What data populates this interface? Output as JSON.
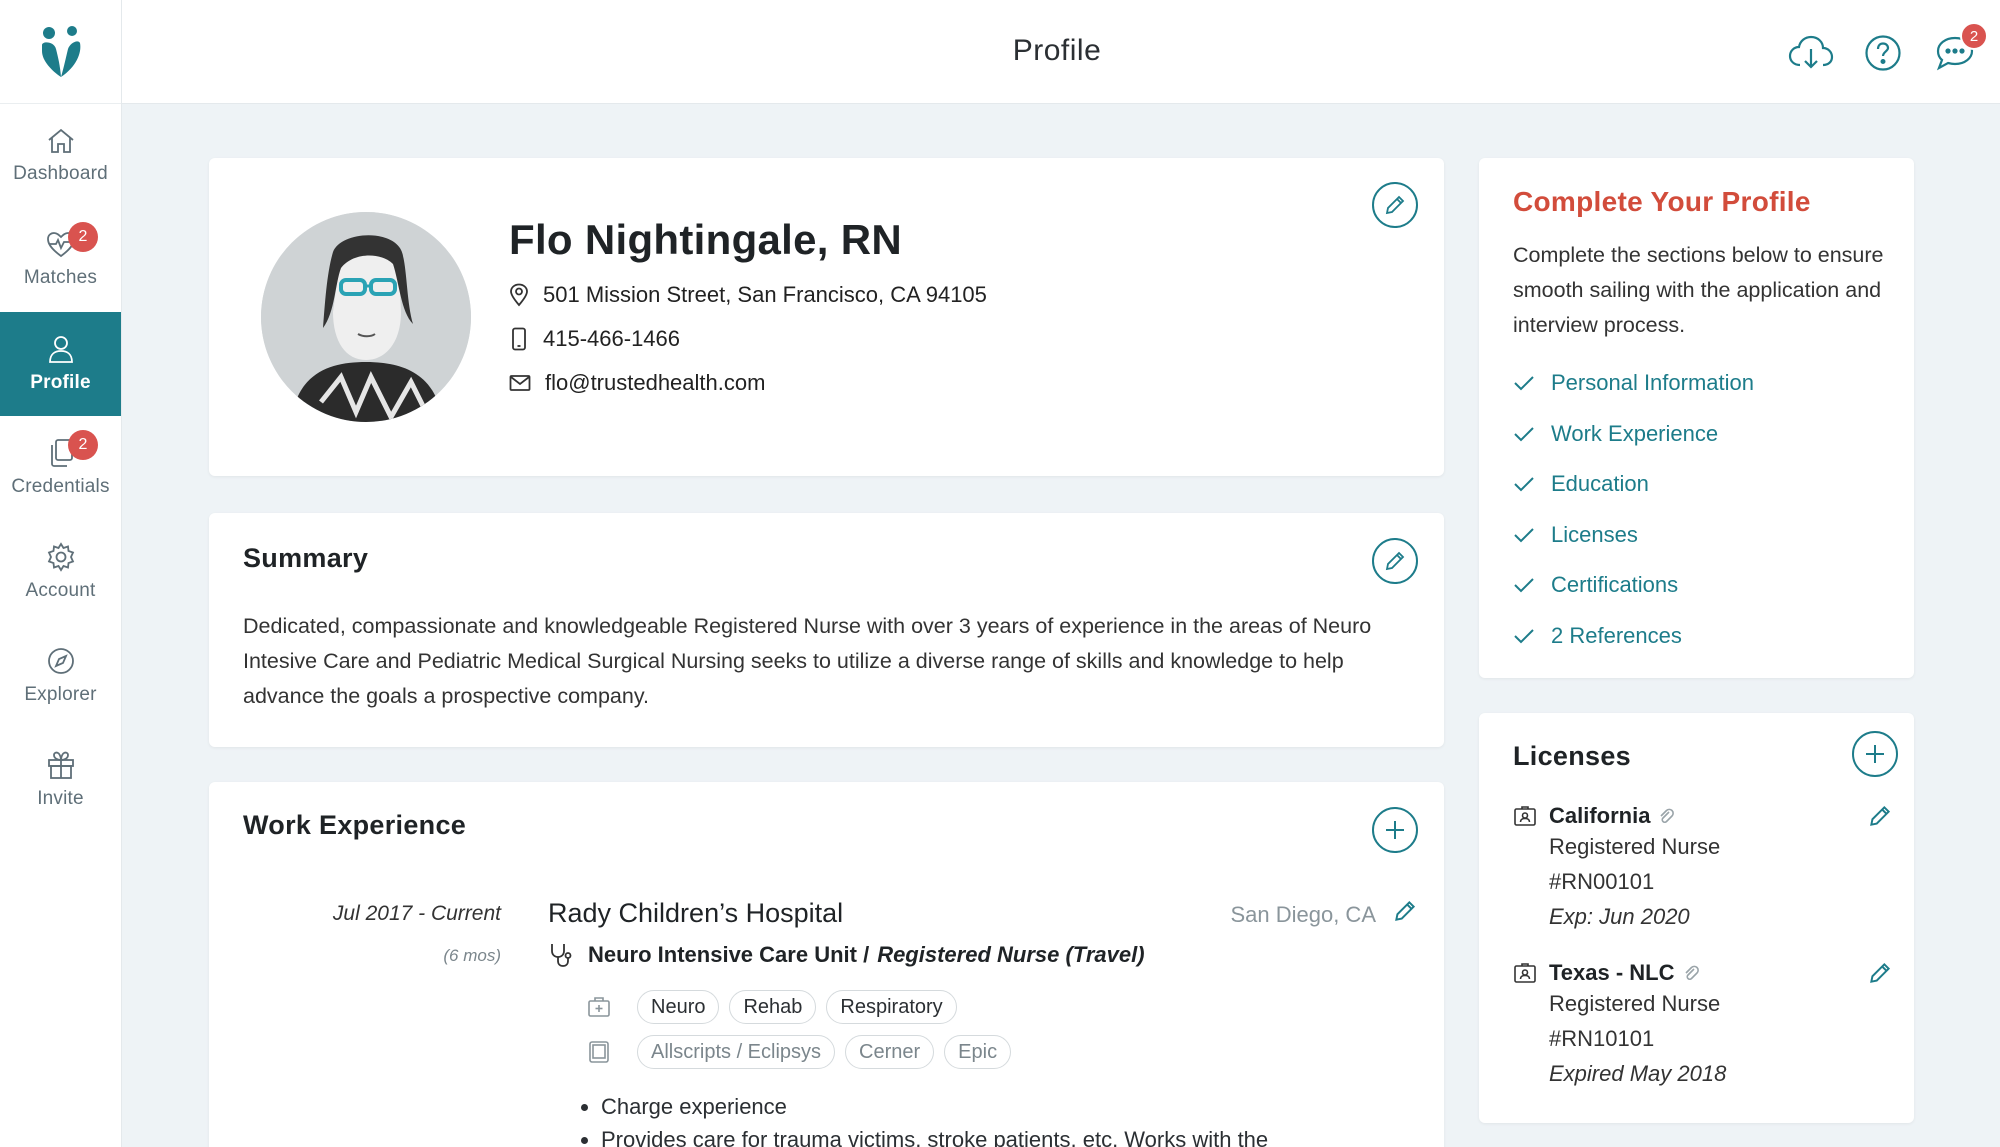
{
  "header": {
    "title": "Profile",
    "message_count": "2"
  },
  "nav": [
    {
      "label": "Dashboard",
      "icon": "home-icon",
      "badge": ""
    },
    {
      "label": "Matches",
      "icon": "heartbeat-icon",
      "badge": "2"
    },
    {
      "label": "Profile",
      "icon": "user-icon",
      "badge": "",
      "active": true
    },
    {
      "label": "Credentials",
      "icon": "documents-icon",
      "badge": "2"
    },
    {
      "label": "Account",
      "icon": "gear-icon",
      "badge": ""
    },
    {
      "label": "Explorer",
      "icon": "compass-icon",
      "badge": ""
    },
    {
      "label": "Invite",
      "icon": "gift-icon",
      "badge": ""
    }
  ],
  "profile": {
    "name": "Flo Nightingale, RN",
    "address": "501 Mission Street, San Francisco, CA 94105",
    "phone": "415-466-1466",
    "email": "flo@trustedhealth.com"
  },
  "summary": {
    "title": "Summary",
    "text": "Dedicated, compassionate and knowledgeable Registered Nurse with over 3 years of experience in the areas of Neuro Intesive Care and Pediatric Medical Surgical Nursing seeks to utilize a diverse range of skills and knowledge to help advance the goals a prospective company."
  },
  "work": {
    "title": "Work Experience",
    "date_range": "Jul 2017 - Current",
    "duration": "(6 mos)",
    "employer": "Rady Children’s Hospital",
    "location": "San Diego, CA",
    "unit": "Neuro Intensive Care Unit /",
    "role": "Registered Nurse (Travel)",
    "specialties": [
      "Neuro",
      "Rehab",
      "Respiratory"
    ],
    "systems": [
      "Allscripts / Eclipsys",
      "Cerner",
      "Epic"
    ],
    "bullets": [
      "Charge experience",
      "Provides care for trauma victims, stroke patients, etc. Works with the"
    ]
  },
  "complete": {
    "title": "Complete Your Profile",
    "description": "Complete the sections below to ensure smooth sailing with the application and interview process.",
    "items": [
      "Personal Information",
      "Work Experience",
      "Education",
      "Licenses",
      "Certifications",
      "2 References"
    ]
  },
  "licenses": {
    "title": "Licenses",
    "items": [
      {
        "state": "California",
        "type": "Registered Nurse",
        "number": "#RN00101",
        "expiry": "Exp: Jun 2020"
      },
      {
        "state": "Texas - NLC",
        "type": "Registered Nurse",
        "number": "#RN10101",
        "expiry": "Expired May 2018"
      }
    ]
  },
  "colors": {
    "accent": "#1d7c8a",
    "alert": "#d24c3b",
    "badge": "#d9534f"
  }
}
